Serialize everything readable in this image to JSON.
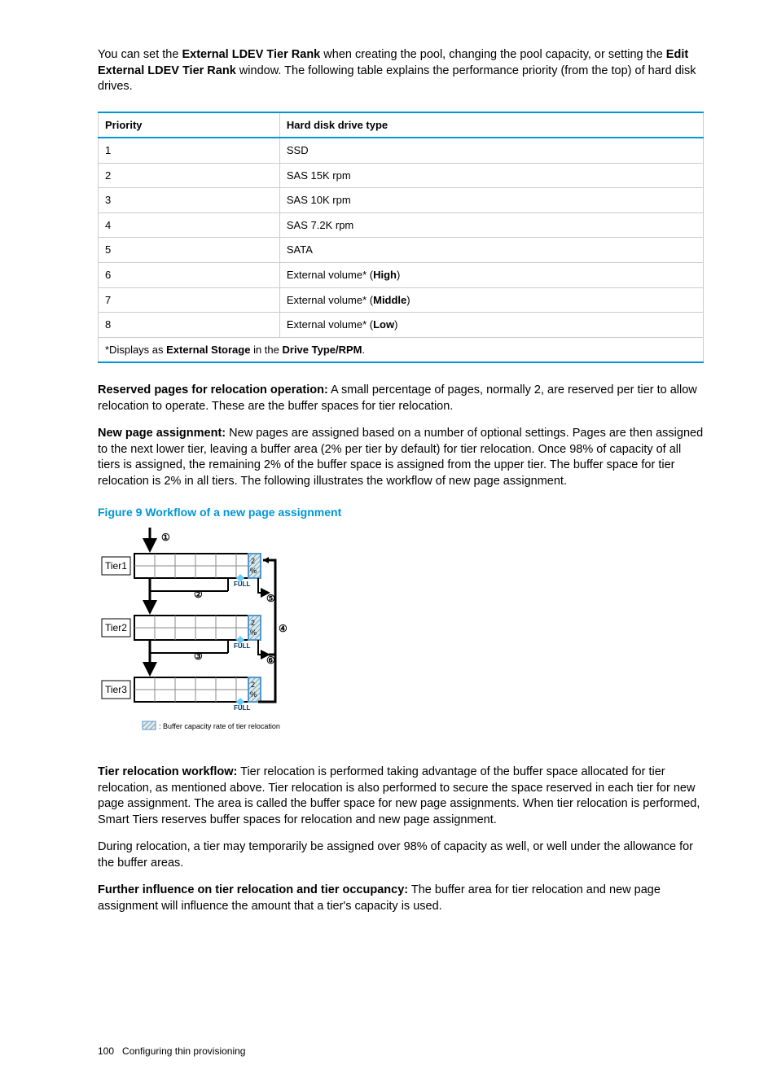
{
  "intro": {
    "part1": "You can set the ",
    "bold1": "External LDEV Tier Rank",
    "part2": " when creating the pool, changing the pool capacity, or setting the ",
    "bold2": "Edit External LDEV Tier Rank",
    "part3": " window. The following table explains the performance priority (from the top) of hard disk drives."
  },
  "table": {
    "headers": [
      "Priority",
      "Hard disk drive type"
    ],
    "rows": [
      {
        "p": "1",
        "d": "SSD"
      },
      {
        "p": "2",
        "d": "SAS 15K rpm"
      },
      {
        "p": "3",
        "d": "SAS 10K rpm"
      },
      {
        "p": "4",
        "d": "SAS 7.2K rpm"
      },
      {
        "p": "5",
        "d": "SATA"
      },
      {
        "p": "6",
        "d_pre": "External volume* (",
        "d_bold": "High",
        "d_post": ")"
      },
      {
        "p": "7",
        "d_pre": "External volume* (",
        "d_bold": "Middle",
        "d_post": ")"
      },
      {
        "p": "8",
        "d_pre": "External volume* (",
        "d_bold": "Low",
        "d_post": ")"
      }
    ],
    "footnote": {
      "pre": "*Displays as ",
      "b1": "External Storage",
      "mid": " in the ",
      "b2": "Drive Type/RPM",
      "post": "."
    }
  },
  "reserved": {
    "title": "Reserved pages for relocation operation:",
    "body": " A small percentage of pages, normally 2, are reserved per tier to allow relocation to operate. These are the buffer spaces for tier relocation."
  },
  "newpage": {
    "title": "New page assignment:",
    "body": " New pages are assigned based on a number of optional settings. Pages are then assigned to the next lower tier, leaving a buffer area (2% per tier by default) for tier relocation. Once 98% of capacity of all tiers is assigned, the remaining 2% of the buffer space is assigned from the upper tier. The buffer space for tier relocation is 2% in all tiers. The following illustrates the workflow of new page assignment."
  },
  "figure": {
    "title": "Figure 9 Workflow of a new page assignment",
    "tiers": [
      "Tier1",
      "Tier2",
      "Tier3"
    ],
    "pct": "2%",
    "full": "FULL",
    "callouts": [
      "①",
      "②",
      "③",
      "④",
      "⑤",
      "⑥"
    ],
    "legend": ": Buffer capacity rate of tier relocation"
  },
  "reloc": {
    "title": "Tier relocation workflow:",
    "body": " Tier relocation is performed taking advantage of the buffer space allocated for tier relocation, as mentioned above. Tier relocation is also performed to secure the space reserved in each tier for new page assignment. The area is called the buffer space for new page assignments. When tier relocation is performed, Smart Tiers reserves buffer spaces for relocation and new page assignment."
  },
  "during": "During relocation, a tier may temporarily be assigned over 98% of capacity as well, or well under the allowance for the buffer areas.",
  "further": {
    "title": "Further influence on tier relocation and tier occupancy:",
    "body": " The buffer area for tier relocation and new page assignment will influence the amount that a tier's capacity is used."
  },
  "footer": {
    "pagenum": "100",
    "section": "Configuring thin provisioning"
  }
}
